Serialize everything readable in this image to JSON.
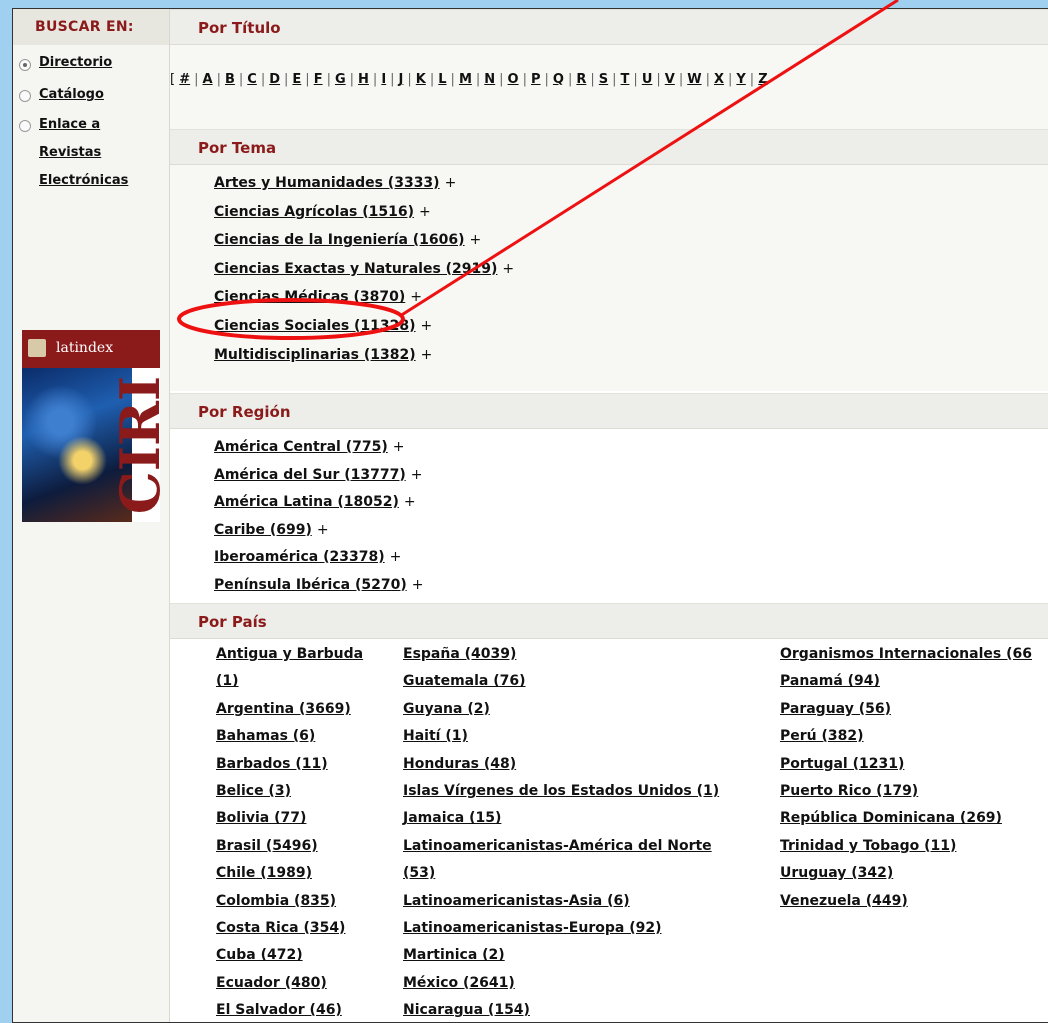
{
  "sidebar": {
    "title": "BUSCAR EN:",
    "options": [
      {
        "label": "Directorio",
        "checked": true
      },
      {
        "label": "Catálogo",
        "checked": false
      },
      {
        "label_lines": [
          "Enlace a",
          "Revistas",
          "Electrónicas"
        ],
        "checked": false
      }
    ],
    "logo": {
      "brand": "latindex",
      "name": "CIRI"
    }
  },
  "titulo": {
    "heading": "Por Título",
    "open": "[",
    "letters": [
      "#",
      "A",
      "B",
      "C",
      "D",
      "E",
      "F",
      "G",
      "H",
      "I",
      "J",
      "K",
      "L",
      "M",
      "N",
      "O",
      "P",
      "Q",
      "R",
      "S",
      "T",
      "U",
      "V",
      "W",
      "X",
      "Y",
      "Z"
    ]
  },
  "tema": {
    "heading": "Por Tema",
    "items": [
      {
        "label": "Artes y Humanidades (3333)",
        "plus": "+"
      },
      {
        "label": "Ciencias Agrícolas (1516)",
        "plus": "+"
      },
      {
        "label": "Ciencias de la Ingeniería (1606)",
        "plus": "+"
      },
      {
        "label": "Ciencias Exactas y Naturales (2919)",
        "plus": "+"
      },
      {
        "label": "Ciencias Médicas (3870)",
        "plus": "+"
      },
      {
        "label": "Ciencias Sociales (11328)",
        "plus": "+"
      },
      {
        "label": "Multidisciplinarias (1382)",
        "plus": "+"
      }
    ]
  },
  "region": {
    "heading": "Por Región",
    "items": [
      {
        "label": "América Central (775)",
        "plus": "+"
      },
      {
        "label": "América del Sur (13777)",
        "plus": "+"
      },
      {
        "label": "América Latina (18052)",
        "plus": "+"
      },
      {
        "label": "Caribe (699)",
        "plus": "+"
      },
      {
        "label": "Iberoamérica (23378)",
        "plus": "+"
      },
      {
        "label": "Península Ibérica (5270)",
        "plus": "+"
      }
    ]
  },
  "pais": {
    "heading": "Por País",
    "col1": [
      "Antigua y Barbuda",
      "(1)",
      "Argentina (3669)",
      "Bahamas (6)",
      "Barbados (11)",
      "Belice (3)",
      "Bolivia (77)",
      "Brasil (5496)",
      "Chile (1989)",
      "Colombia (835)",
      "Costa Rica (354)",
      "Cuba (472)",
      "Ecuador (480)",
      "El Salvador (46)"
    ],
    "col2": [
      "España (4039)",
      "Guatemala (76)",
      "Guyana (2)",
      "Haití (1)",
      "Honduras (48)",
      "Islas Vírgenes de los Estados Unidos (1)",
      "Jamaica (15)",
      "Latinoamericanistas-América del Norte",
      "(53)",
      "Latinoamericanistas-Asia (6)",
      "Latinoamericanistas-Europa (92)",
      "Martinica (2)",
      "México (2641)",
      "Nicaragua (154)"
    ],
    "col3": [
      "Organismos Internacionales (66",
      "Panamá (94)",
      "Paraguay (56)",
      "Perú (382)",
      "Portugal (1231)",
      "Puerto Rico (179)",
      "República Dominicana (269)",
      "Trinidad y Tobago (11)",
      "Uruguay (342)",
      "Venezuela (449)"
    ]
  },
  "annotation": {
    "color": "#ee1111"
  }
}
